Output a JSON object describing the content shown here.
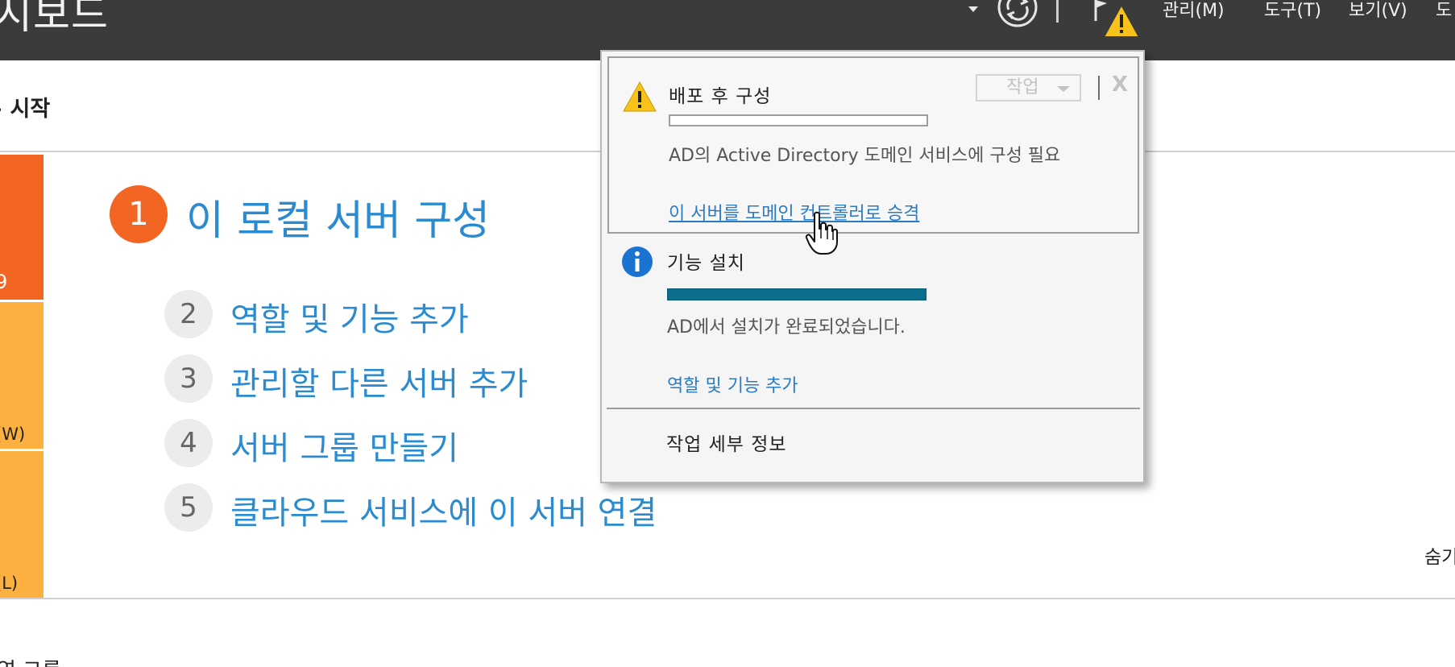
{
  "app": {
    "title": "시보드"
  },
  "topbar": {
    "menu": [
      {
        "label": "관리(M)"
      },
      {
        "label": "도구(T)"
      },
      {
        "label": "보기(V)"
      },
      {
        "label": "도"
      }
    ]
  },
  "header": {
    "breadcrumb": "시작"
  },
  "tiles": [
    {
      "label": "9"
    },
    {
      "label": "(W)"
    },
    {
      "label": "(L)"
    }
  ],
  "quick_start": {
    "main_step": {
      "number": "1",
      "label": "이 로컬 서버 구성"
    },
    "steps": [
      {
        "number": "2",
        "label": "역할 및 기능 추가"
      },
      {
        "number": "3",
        "label": "관리할 다른 서버 추가"
      },
      {
        "number": "4",
        "label": "서버 그룹 만들기"
      },
      {
        "number": "5",
        "label": "클라우드 서비스에 이 서버 연결"
      }
    ],
    "hide_label": "숨기기",
    "bottom_label": "역 그룹"
  },
  "notifications": {
    "post_deploy": {
      "title": "배포 후 구성",
      "task_label": "작업",
      "close_label": "X",
      "progress": 0,
      "description": "AD의 Active Directory 도메인 서비스에 구성 필요",
      "link": "이 서버를 도메인 컨트롤러로 승격"
    },
    "feature_install": {
      "title": "기능 설치",
      "progress": 1.0,
      "description": "AD에서 설치가 완료되었습니다.",
      "link": "역할 및 기능 추가"
    },
    "task_details": "작업 세부 정보"
  },
  "colors": {
    "topbar": "#3b3b3b",
    "accent_orange": "#f26522",
    "tile_yellow": "#fbb040",
    "link_blue": "#2a8bd0",
    "progress_teal": "#0b6e8c",
    "warning_yellow": "#f7c31a",
    "info_blue": "#1a73d0"
  },
  "icons": {
    "refresh": "refresh-icon",
    "flag_warning": "flag-warning-icon",
    "warning": "warning-icon",
    "info": "info-icon",
    "cursor": "hand-cursor-icon"
  }
}
